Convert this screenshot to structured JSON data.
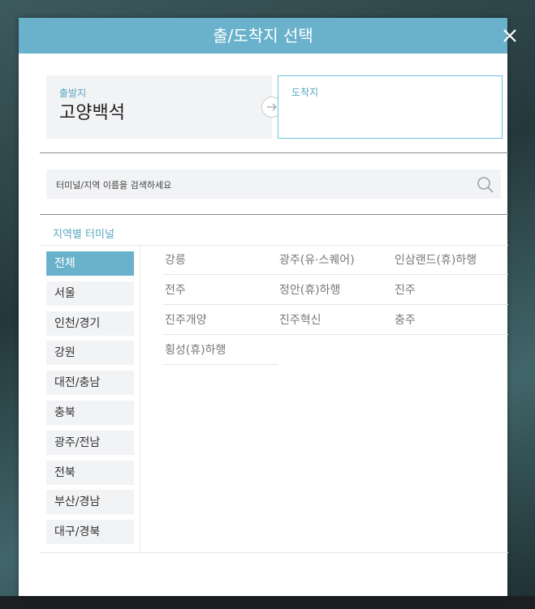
{
  "modal": {
    "title": "출/도착지 선택"
  },
  "route": {
    "departure_label": "출발지",
    "departure_value": "고양백석",
    "arrival_label": "도착지",
    "arrival_value": ""
  },
  "search": {
    "placeholder": "터미널/지역 이름을 검색하세요",
    "value": ""
  },
  "section": {
    "title": "지역별 터미널"
  },
  "regions": [
    {
      "label": "전체",
      "active": true
    },
    {
      "label": "서울",
      "active": false
    },
    {
      "label": "인천/경기",
      "active": false
    },
    {
      "label": "강원",
      "active": false
    },
    {
      "label": "대전/충남",
      "active": false
    },
    {
      "label": "충북",
      "active": false
    },
    {
      "label": "광주/전남",
      "active": false
    },
    {
      "label": "전북",
      "active": false
    },
    {
      "label": "부산/경남",
      "active": false
    },
    {
      "label": "대구/경북",
      "active": false
    }
  ],
  "terminals": [
    "강릉",
    "광주(유·스퀘어)",
    "인삼랜드(휴)하행",
    "전주",
    "정안(휴)하행",
    "진주",
    "진주개양",
    "진주혁신",
    "충주",
    "횡성(휴)하행"
  ],
  "colors": {
    "accent": "#6ab2cc",
    "label_blue": "#5aa6c4",
    "arrival_border": "#6cc3de"
  },
  "icons": [
    "close-icon",
    "arrow-right-icon",
    "search-icon"
  ]
}
